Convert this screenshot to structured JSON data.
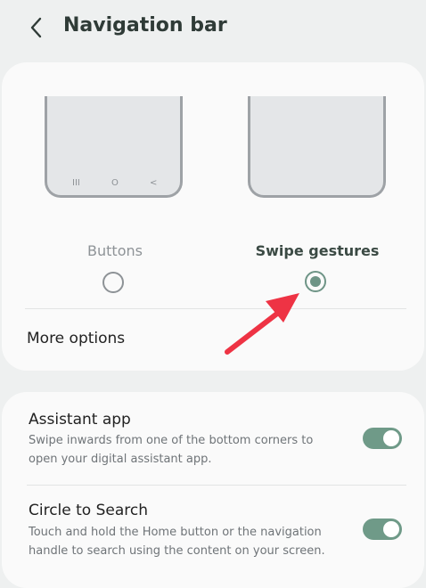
{
  "header": {
    "title": "Navigation bar",
    "back_icon": "chevron-left-icon"
  },
  "navigation_type": {
    "options": [
      {
        "label": "Buttons",
        "selected": false
      },
      {
        "label": "Swipe gestures",
        "selected": true
      }
    ],
    "preview_keys": [
      "III",
      "O",
      "<"
    ]
  },
  "more_options": {
    "label": "More options"
  },
  "settings": [
    {
      "title": "Assistant app",
      "description": "Swipe inwards from one of the bottom corners to open your digital assistant app.",
      "enabled": true
    },
    {
      "title": "Circle to Search",
      "description": "Touch and hold the Home button or the navigation handle to search using the content on your screen.",
      "enabled": true
    }
  ],
  "colors": {
    "accent": "#6f9a88",
    "annotation_arrow": "#ee3344"
  }
}
